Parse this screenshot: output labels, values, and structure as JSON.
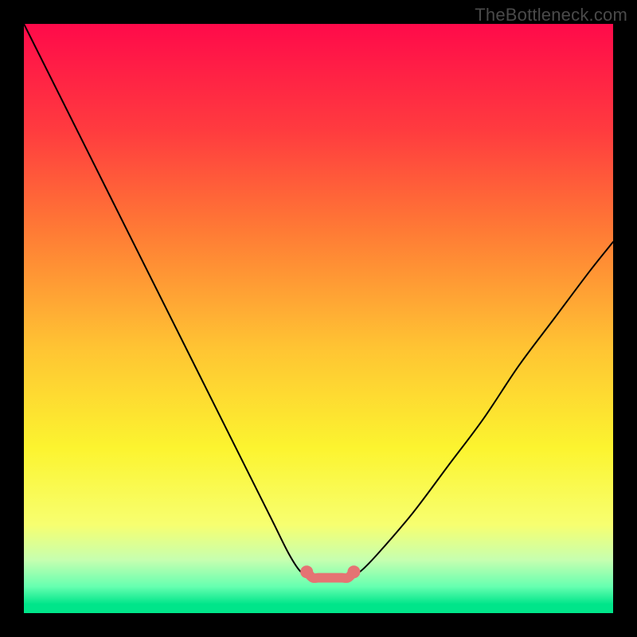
{
  "watermark": "TheBottleneck.com",
  "chart_data": {
    "type": "line",
    "title": "",
    "xlabel": "",
    "ylabel": "",
    "xlim": [
      0,
      100
    ],
    "ylim": [
      0,
      100
    ],
    "grid": false,
    "legend": false,
    "series": [
      {
        "name": "curve-left",
        "color": "#000000",
        "x": [
          0,
          6,
          12,
          18,
          24,
          30,
          36,
          42,
          45,
          47,
          48
        ],
        "y": [
          100,
          88,
          76,
          64,
          52,
          40,
          28,
          16,
          10,
          7,
          7
        ]
      },
      {
        "name": "curve-right",
        "color": "#000000",
        "x": [
          56,
          57,
          60,
          66,
          72,
          78,
          84,
          90,
          96,
          100
        ],
        "y": [
          7,
          7,
          10,
          17,
          25,
          33,
          42,
          50,
          58,
          63
        ]
      },
      {
        "name": "bottleneck-band",
        "type": "scatter",
        "color": "#e57373",
        "x": [
          48,
          49,
          50,
          51,
          52,
          53,
          54,
          55,
          56
        ],
        "y": [
          7,
          6,
          6,
          6,
          6,
          6,
          6,
          6,
          7
        ]
      }
    ],
    "gradient_stops": [
      {
        "pos": 0.0,
        "color": "#ff0a4a"
      },
      {
        "pos": 0.18,
        "color": "#ff3b3f"
      },
      {
        "pos": 0.35,
        "color": "#ff7a35"
      },
      {
        "pos": 0.55,
        "color": "#ffc433"
      },
      {
        "pos": 0.72,
        "color": "#fcf42f"
      },
      {
        "pos": 0.85,
        "color": "#f7ff70"
      },
      {
        "pos": 0.91,
        "color": "#c6ffb0"
      },
      {
        "pos": 0.955,
        "color": "#66ffb0"
      },
      {
        "pos": 0.985,
        "color": "#00e58a"
      },
      {
        "pos": 1.0,
        "color": "#00e58a"
      }
    ]
  }
}
